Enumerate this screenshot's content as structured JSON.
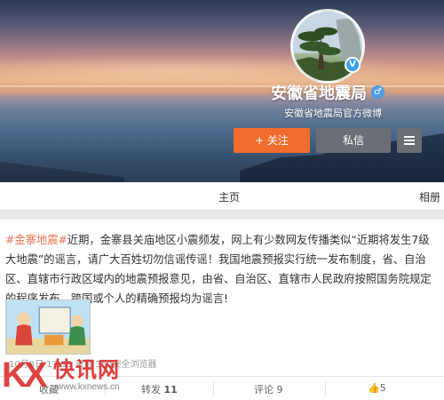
{
  "profile": {
    "name": "安徽省地震局",
    "description": "安徽省地震局官方微博",
    "verified_mark": "V",
    "gender_mark": "♂"
  },
  "actions": {
    "follow_label": "+ 关注",
    "message_label": "私信"
  },
  "tabs": {
    "home": "主页",
    "album": "相册"
  },
  "post": {
    "hashtag": "#金寨地震#",
    "text": "近期，金寨县关庙地区小震频发，网上有少数网友传播类似“近期将发生7级大地震”的谣言，请广大百姓切勿信谣传谣！我国地震预报实行统一发布制度，省、自治区、直辖市行政区域内的地震预报意见，由省、自治区、直辖市人民政府按照国务院规定的程序发布。跨国或个人的精确预报均为谣言!",
    "source": "10月8日 17:35 来自 360安全浏览器",
    "favorite_label": "收藏",
    "repost_label": "转发",
    "repost_count": "11",
    "comment_label": "评论",
    "comment_count": "9",
    "like_count": "5"
  },
  "watermark": {
    "logo": "KX",
    "brand": "快讯网",
    "url": "www.kxnews.cn"
  }
}
